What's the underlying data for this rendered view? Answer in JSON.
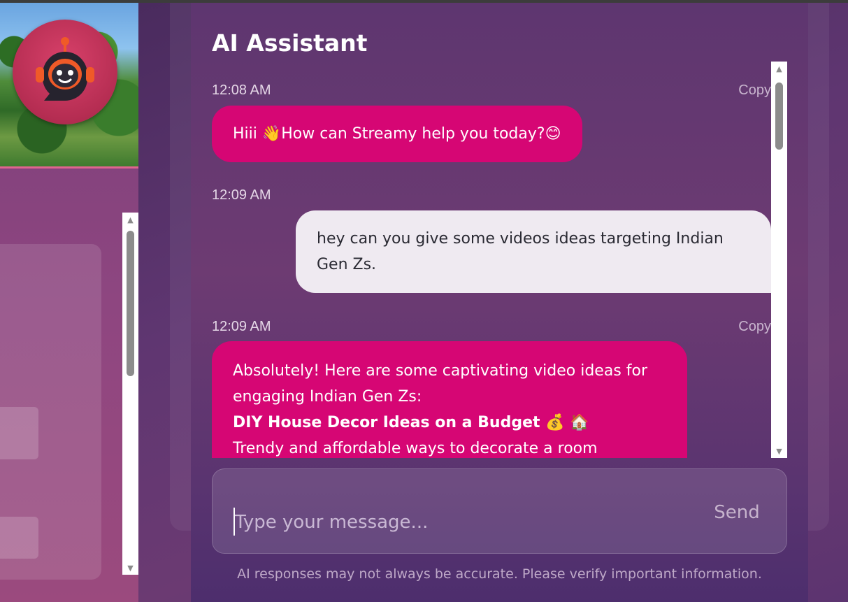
{
  "assistant": {
    "title": "AI Assistant",
    "messages": [
      {
        "role": "ai",
        "time": "12:08 AM",
        "copy_label": "Copy",
        "text": "Hiii 👋How can Streamy help you today?😊"
      },
      {
        "role": "user",
        "time": "12:09 AM",
        "lines": [
          "hey can you give some videos ideas targeting Indian",
          "Gen Zs."
        ]
      },
      {
        "role": "ai",
        "time": "12:09 AM",
        "copy_label": "Copy",
        "lines": [
          "Absolutely! Here are some captivating video ideas for",
          "engaging Indian Gen Zs:"
        ],
        "heading": "DIY House Decor Ideas on a Budget 💰 🏠",
        "tail": "Trendy and affordable ways to decorate a room"
      }
    ],
    "input": {
      "placeholder": "Type your message...",
      "value": ""
    },
    "send_label": "Send",
    "disclaimer": "AI responses may not always be accurate. Please verify important information."
  },
  "icons": {
    "avatar": "robot-avatar-icon",
    "scroll_up": "scroll-up-arrow-icon",
    "scroll_down": "scroll-down-arrow-icon"
  },
  "colors": {
    "ai_bubble": "#d60674",
    "user_bubble": "#efeaf1",
    "avatar_bg": "#c7355d"
  }
}
